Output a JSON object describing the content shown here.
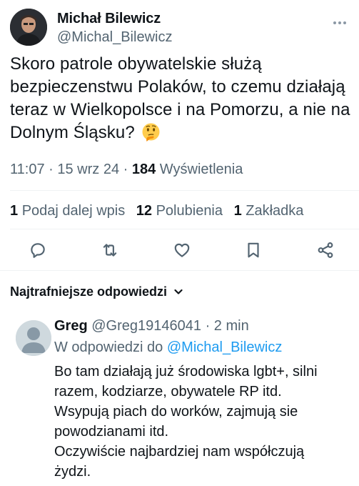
{
  "tweet": {
    "author_name": "Michał Bilewicz",
    "author_handle": "@Michal_Bilewicz",
    "text": "Skoro patrole obywatelskie służą bezpieczenstwu Polaków, to czemu działają teraz w Wielkopolsce i na Pomorzu, a nie na Dolnym Śląsku?",
    "emoji": "thinking-face-emoji",
    "time": "11:07",
    "date": "15 wrz 24",
    "views_count": "184",
    "views_label": "Wyświetlenia"
  },
  "stats": {
    "reposts_count": "1",
    "reposts_label": "Podaj dalej wpis",
    "likes_count": "12",
    "likes_label": "Polubienia",
    "bookmarks_count": "1",
    "bookmarks_label": "Zakładka"
  },
  "actions": [
    "reply-icon",
    "repost-icon",
    "like-icon",
    "bookmark-icon",
    "share-icon"
  ],
  "replies_sort": {
    "label": "Najtrafniejsze odpowiedzi"
  },
  "reply": {
    "name": "Greg",
    "handle": "@Greg19146041",
    "time": "2 min",
    "replying_to_prefix": "W odpowiedzi do",
    "replying_to_handle": "@Michal_Bilewicz",
    "lines": [
      "Bo tam działają już środowiska lgbt+, silni",
      "razem, kodziarze, obywatele RP itd.",
      "Wsypują piach do worków, zajmują sie",
      "powodzianami itd.",
      "Oczywiście najbardziej nam współczują",
      "żydzi."
    ]
  },
  "colors": {
    "text": "#0f1419",
    "secondary": "#536471",
    "link": "#1d9bf0",
    "divider": "#eff3f4"
  }
}
